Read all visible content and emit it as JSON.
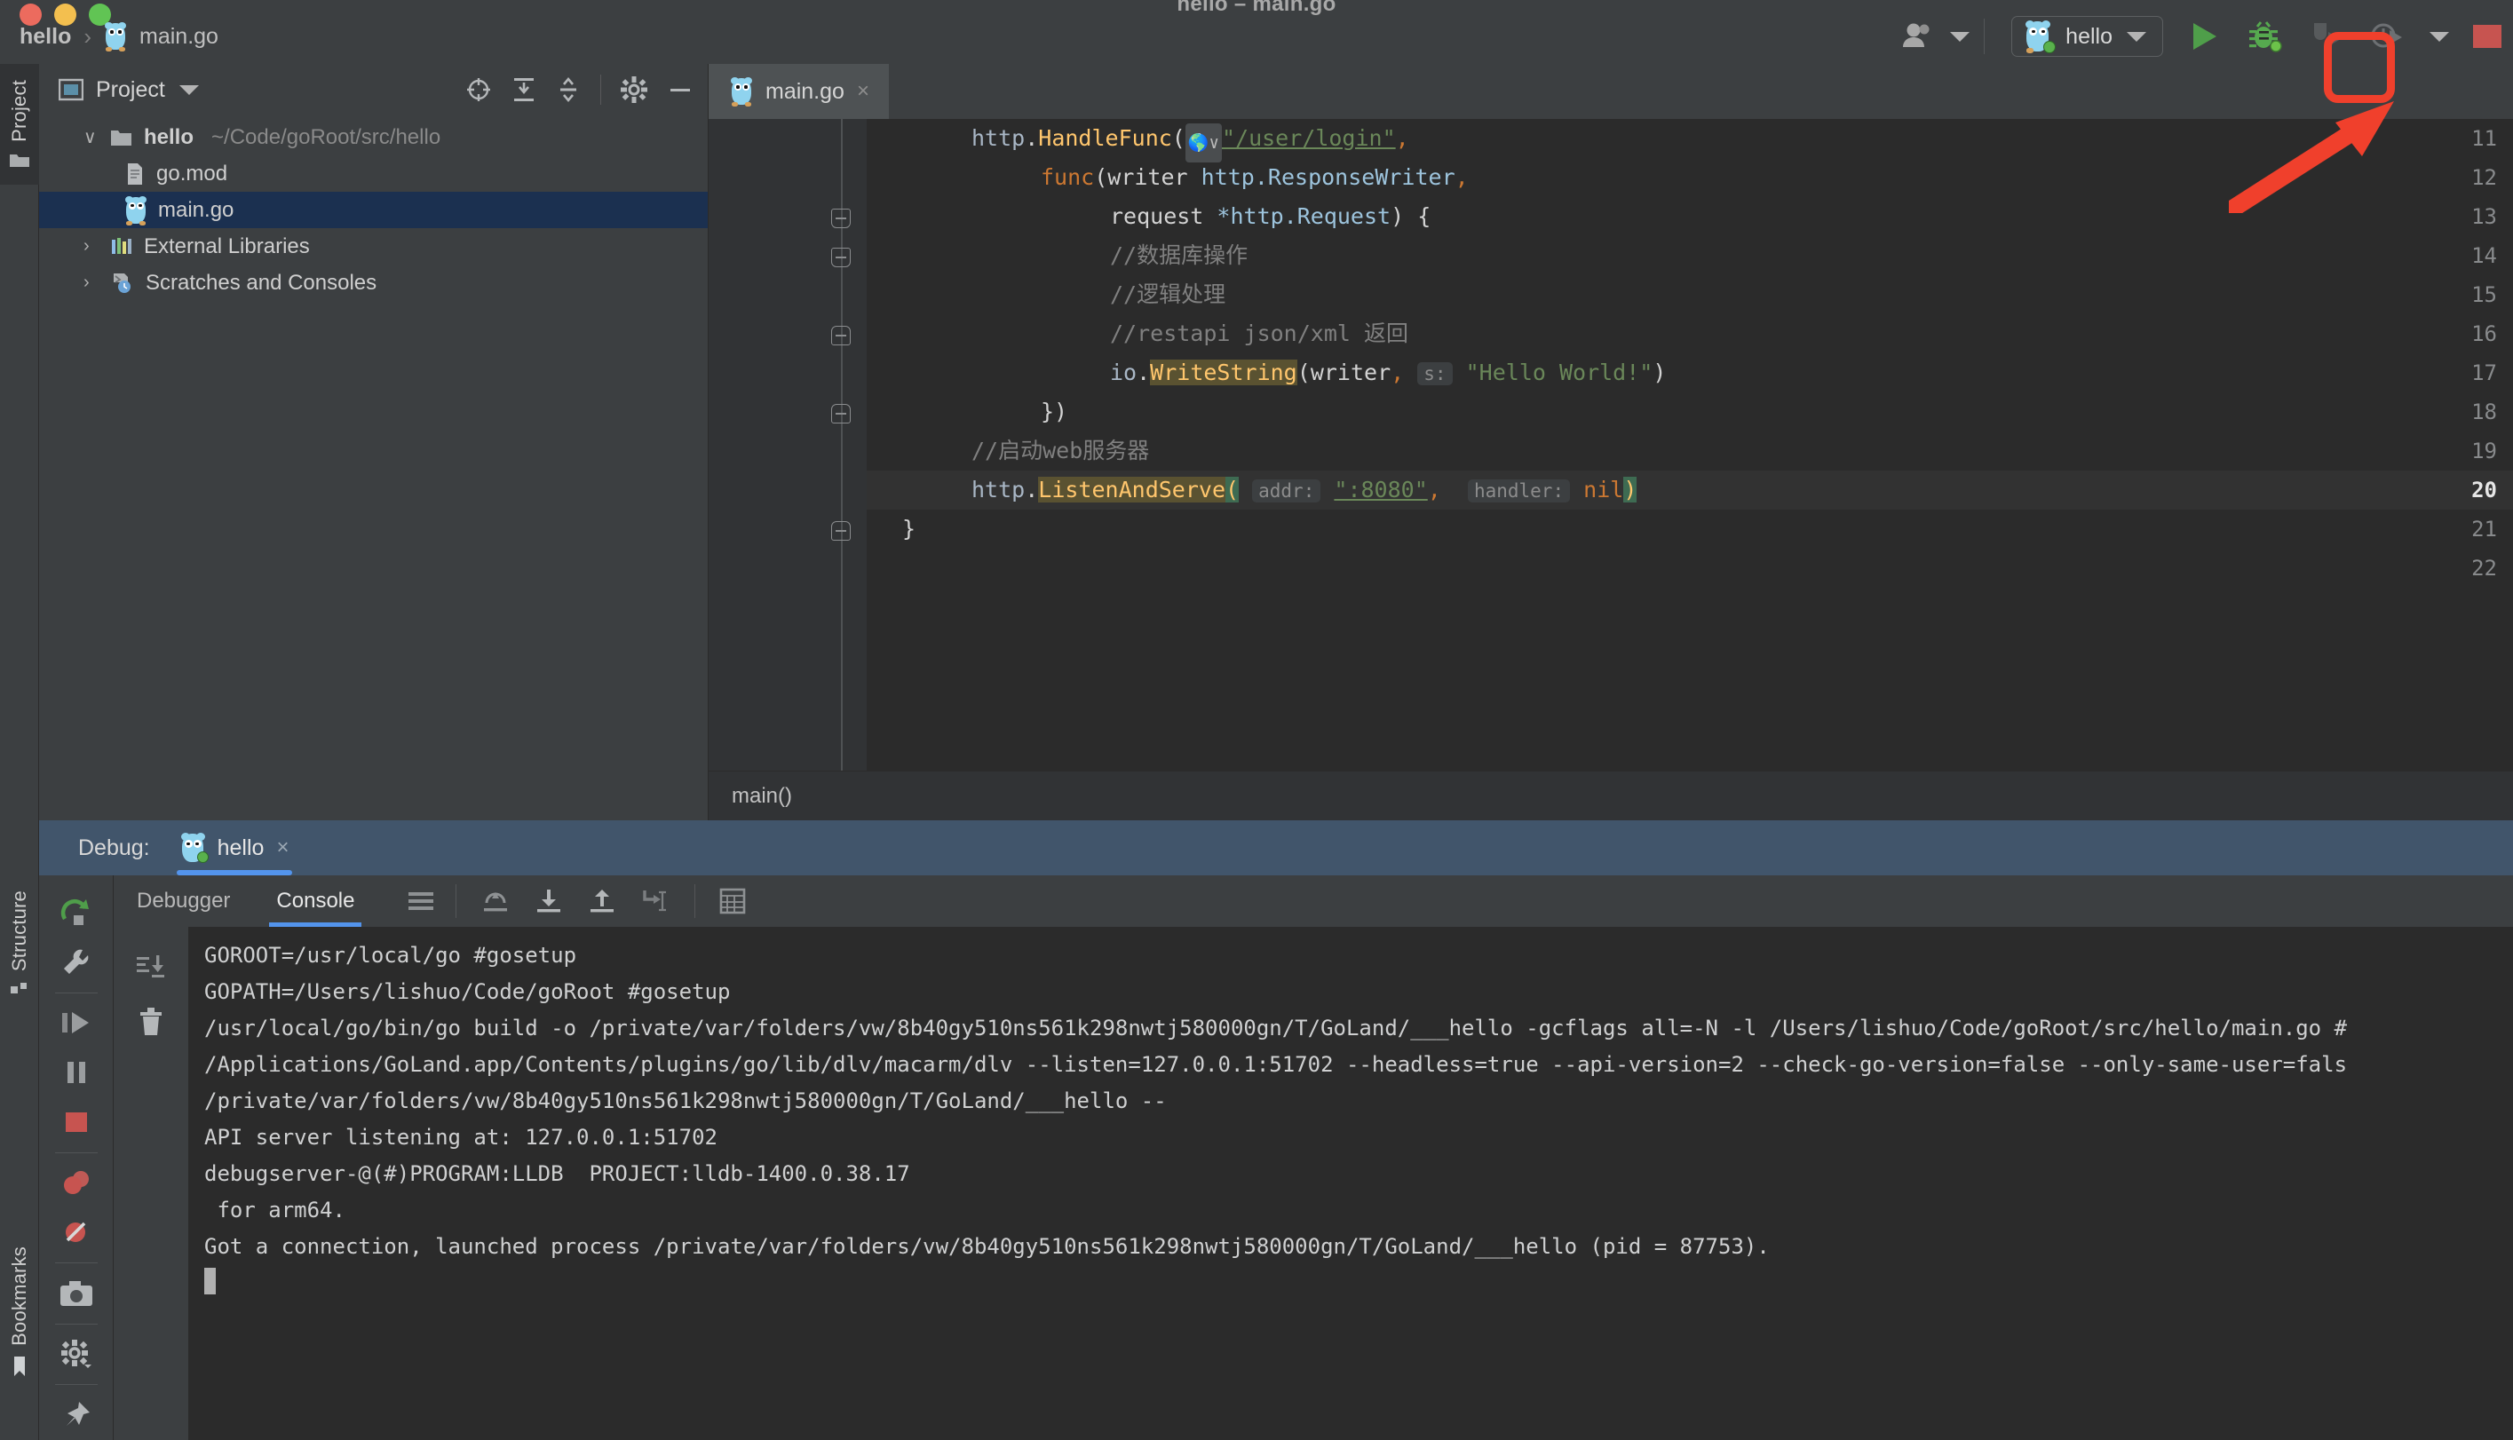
{
  "window": {
    "title": "hello – main.go"
  },
  "breadcrumb": {
    "project": "hello",
    "separator": "›",
    "file": "main.go"
  },
  "toolbar": {
    "account_icon": "user-account-icon",
    "run_config_name": "hello",
    "run_label": "run-icon",
    "debug_label": "debug-icon",
    "attach_label": "attach-to-process-icon",
    "profile_label": "profiler-icon",
    "stop_label": "stop-icon"
  },
  "left_strip": {
    "tabs": [
      "Project"
    ]
  },
  "project_panel": {
    "title": "Project",
    "actions": [
      "locate-icon",
      "expand-all-icon",
      "collapse-all-icon",
      "settings-icon",
      "hide-icon"
    ],
    "tree": [
      {
        "indent": 0,
        "arrow": "∨",
        "name": "hello",
        "bold": true,
        "path": "~/Code/goRoot/src/hello",
        "icon": "folder-icon",
        "selected": false
      },
      {
        "indent": 1,
        "arrow": "",
        "name": "go.mod",
        "bold": false,
        "path": "",
        "icon": "file-icon",
        "selected": false
      },
      {
        "indent": 1,
        "arrow": "",
        "name": "main.go",
        "bold": false,
        "path": "",
        "icon": "go-file-icon",
        "selected": true
      },
      {
        "indent": 0,
        "arrow": "›",
        "name": "External Libraries",
        "bold": false,
        "path": "",
        "icon": "library-icon",
        "selected": false
      },
      {
        "indent": 0,
        "arrow": "›",
        "name": "Scratches and Consoles",
        "bold": false,
        "path": "",
        "icon": "scratches-icon",
        "selected": false
      }
    ]
  },
  "editor": {
    "tab_name": "main.go",
    "tab_close": "×",
    "breadcrumb": "main()",
    "current_line": 20,
    "line_numbers": [
      11,
      12,
      13,
      14,
      15,
      16,
      17,
      18,
      19,
      20,
      21,
      22
    ],
    "code": {
      "l11": "http.HandleFunc(\"/user/login\",",
      "l12": "func(writer http.ResponseWriter,",
      "l13": "request *http.Request) {",
      "l14": "//数据库操作",
      "l15": "//逻辑处理",
      "l16": "//restapi json/xml 返回",
      "l17": "io.WriteString(writer, s: \"Hello World!\")",
      "l18": "})",
      "l19": "//启动web服务器",
      "l20": "http.ListenAndServe( addr: \":8080\",  handler: nil)",
      "l21": "}",
      "l22": ""
    },
    "tokens": {
      "http": "http",
      "dot": ".",
      "handlefunc": "HandleFunc",
      "lparen": "(",
      "url_string": "\"/user/login\"",
      "comma": ",",
      "func_kw": "func",
      "writer": "writer",
      "resp_writer": "http.ResponseWriter",
      "request": "request",
      "star_req": "*http.Request",
      "rparen_brace": ") {",
      "cmt_db": "//数据库操作",
      "cmt_logic": "//逻辑处理",
      "cmt_rest": "//restapi json/xml 返回",
      "io": "io",
      "writestring": "WriteString",
      "hint_s": "s:",
      "hello_world": "\"Hello World!\"",
      "close_brace_paren": "})",
      "cmt_web": "//启动web服务器",
      "listenandserve": "ListenAndServe",
      "hint_addr": "addr:",
      "port_string": "\":8080\"",
      "hint_handler": "handler:",
      "nil_kw": "nil",
      "rparen": ")",
      "close_brace": "}"
    }
  },
  "debug": {
    "label": "Debug:",
    "session_name": "hello",
    "session_close": "×",
    "tabs": [
      {
        "label": "Debugger",
        "active": false
      },
      {
        "label": "Console",
        "active": true
      }
    ],
    "toolbar_icons": [
      "layout-icon",
      "step-over-icon",
      "step-into-icon",
      "step-out-icon",
      "run-to-cursor-icon",
      "evaluate-icon"
    ],
    "sidebar_icons": [
      "rerun-icon",
      "settings-wrench-icon",
      "resume-icon",
      "pause-icon",
      "stop-icon",
      "mute-breakpoints-icon",
      "view-breakpoints-icon",
      "camera-icon",
      "settings-gear-icon",
      "pin-icon"
    ],
    "console_gutter_icons": [
      "scroll-to-end-icon",
      "trash-icon"
    ],
    "console_lines": [
      "GOROOT=/usr/local/go #gosetup",
      "GOPATH=/Users/lishuo/Code/goRoot #gosetup",
      "/usr/local/go/bin/go build -o /private/var/folders/vw/8b40gy510ns561k298nwtj580000gn/T/GoLand/___hello -gcflags all=-N -l /Users/lishuo/Code/goRoot/src/hello/main.go #",
      "/Applications/GoLand.app/Contents/plugins/go/lib/dlv/macarm/dlv --listen=127.0.0.1:51702 --headless=true --api-version=2 --check-go-version=false --only-same-user=fals",
      "/private/var/folders/vw/8b40gy510ns561k298nwtj580000gn/T/GoLand/___hello --",
      "API server listening at: 127.0.0.1:51702",
      "debugserver-@(#)PROGRAM:LLDB  PROJECT:lldb-1400.0.38.17",
      " for arm64.",
      "Got a connection, launched process /private/var/folders/vw/8b40gy510ns561k298nwtj580000gn/T/GoLand/___hello (pid = 87753)."
    ]
  },
  "bottom_strip": {
    "tabs": [
      "Structure",
      "Bookmarks"
    ]
  },
  "annotation": {
    "color": "#f0402c",
    "target": "debug-icon"
  },
  "colors": {
    "bg": "#3c3f41",
    "editor_bg": "#2b2b2b",
    "gutter": "#313335",
    "selection": "#1b3050",
    "accent_blue": "#5394ec",
    "debug_header": "#41556b",
    "green": "#59b14c",
    "red": "#c75450",
    "annotation_red": "#f0402c"
  }
}
